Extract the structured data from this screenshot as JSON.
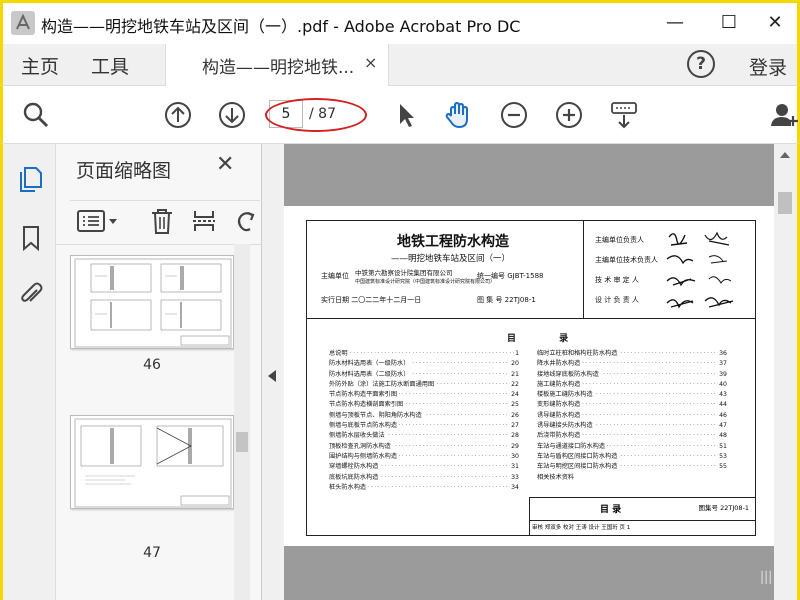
{
  "window": {
    "title": "构造——明挖地铁车站及区间（一）.pdf - Adobe Acrobat Pro DC",
    "minimize": "—",
    "maximize": "☐",
    "close": "✕"
  },
  "tabs": {
    "home": "主页",
    "tools": "工具",
    "document": "构造——明挖地铁...",
    "close": "×",
    "help": "?",
    "login": "登录"
  },
  "toolbar": {
    "current_page": "5",
    "total_pages": "/ 87"
  },
  "thumbnails": {
    "title": "页面缩略图",
    "close": "✕",
    "pages": [
      "46",
      "47"
    ]
  },
  "document": {
    "title": "地铁工程防水构造",
    "subtitle": "——明挖地铁车站及区间（一）",
    "editor_label": "主编单位",
    "editor_1": "中铁第六勘察设计院集团有限公司",
    "editor_2": "中国建筑标准设计研究院（中国建筑标准设计研究院有限公司）",
    "code_label": "统一编号 GJBT-1588",
    "date_label": "实行日期 二〇二二年十二月一日",
    "atlas_label": "图 集 号 22TJ08-1",
    "roles": [
      "主编单位负责人",
      "主编单位技术负责人",
      "技 术 审 定 人",
      "设 计 负 责 人"
    ],
    "toc_heading": "目 录",
    "toc_left": [
      {
        "t": "总说明",
        "n": "1"
      },
      {
        "t": "防水材料选用表（一级防水）",
        "n": "20"
      },
      {
        "t": "防水材料选用表（二级防水）",
        "n": "21"
      },
      {
        "t": "外防外贴（涂）法施工防水断面通用图",
        "n": "22"
      },
      {
        "t": "节点防水构造平面索引图",
        "n": "24"
      },
      {
        "t": "节点防水构造横剖面索引图",
        "n": "25"
      },
      {
        "t": "侧墙与顶板节点、阴阳角防水构造",
        "n": "26"
      },
      {
        "t": "侧墙与底板节点防水构造",
        "n": "27"
      },
      {
        "t": "侧墙防水层收头做法",
        "n": "28"
      },
      {
        "t": "顶板检查孔洞防水构造",
        "n": "29"
      },
      {
        "t": "围护结构与侧墙防水构造",
        "n": "30"
      },
      {
        "t": "穿墙螺栓防水构造",
        "n": "31"
      },
      {
        "t": "底板坑底防水构造",
        "n": "33"
      },
      {
        "t": "桩头防水构造",
        "n": "34"
      }
    ],
    "toc_right": [
      {
        "t": "临时立柱桩和格构柱防水构造",
        "n": "36"
      },
      {
        "t": "降水井防水构造",
        "n": "37"
      },
      {
        "t": "接地线穿底板防水构造",
        "n": "39"
      },
      {
        "t": "施工缝防水构造",
        "n": "40"
      },
      {
        "t": "楼板施工缝防水构造",
        "n": "43"
      },
      {
        "t": "变形缝防水构造",
        "n": "44"
      },
      {
        "t": "诱导缝防水构造",
        "n": "46"
      },
      {
        "t": "诱导缝接头防水构造",
        "n": "47"
      },
      {
        "t": "后浇带防水构造",
        "n": "48"
      },
      {
        "t": "车站与通道接口防水构造",
        "n": "51"
      },
      {
        "t": "车站与盾构区间接口防水构造",
        "n": "53"
      },
      {
        "t": "车站与明挖区间接口防水构造",
        "n": "55"
      },
      {
        "t": "相关技术资料",
        "n": ""
      }
    ],
    "footer_title": "目 录",
    "footer_num": "图集号 22TJ08-1",
    "footer_row": "审核 郑双多  校对 王涛  设计 王国珩  页 1"
  },
  "colors": {
    "accent_border": "#f5d800",
    "annotation": "#d42020",
    "doc_background": "#9b9b9b"
  }
}
